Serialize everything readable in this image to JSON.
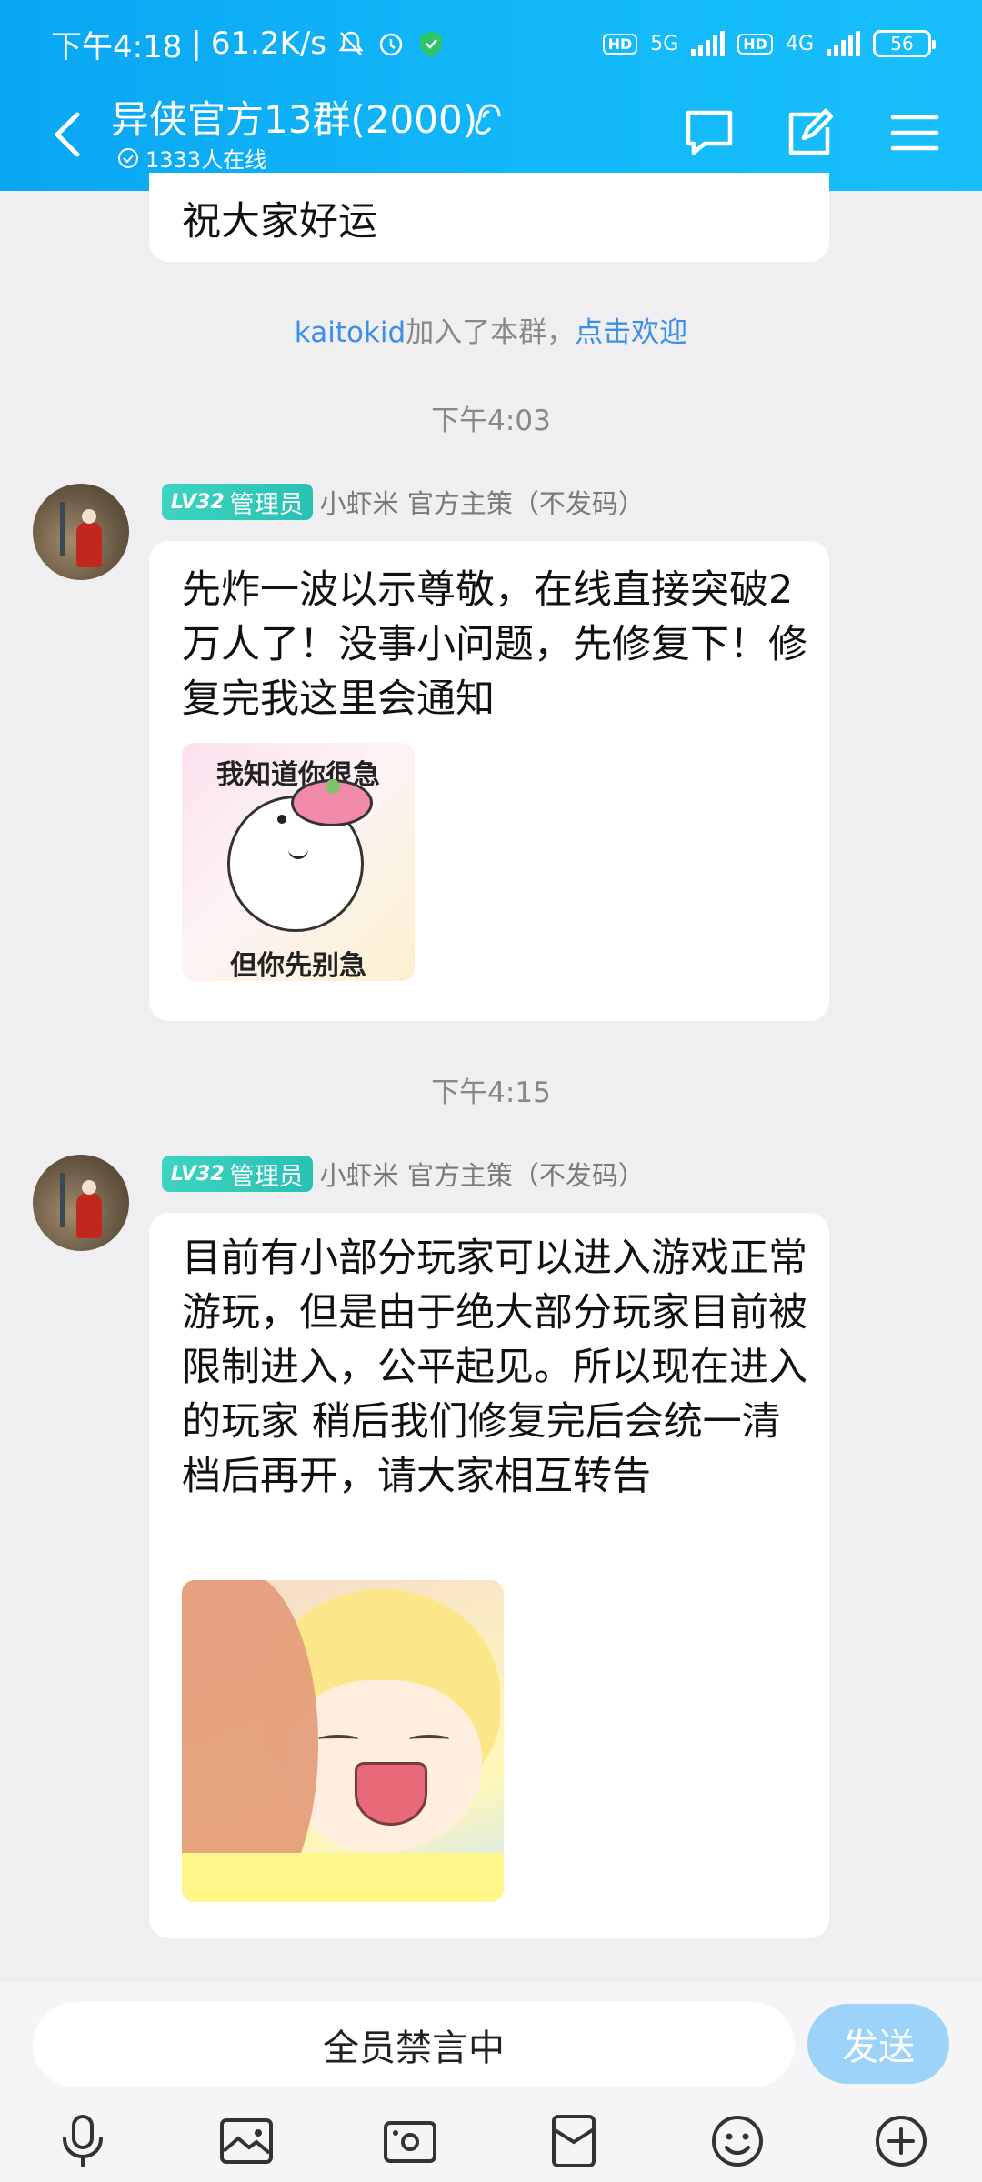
{
  "status_bar": {
    "time": "下午4:18",
    "speed": "61.2K/s",
    "network1": "5G",
    "network2": "4G",
    "hd": "HD",
    "battery": "56"
  },
  "header": {
    "title": "异侠官方13群(2000)",
    "online": "1333人在线",
    "icons": [
      "back-arrow",
      "ear-icon",
      "chat-icon",
      "edit-icon",
      "menu-icon"
    ]
  },
  "messages": {
    "prev_bubble_text": "祝大家好运",
    "join_notice": {
      "user": "kaitokid",
      "text": "加入了本群，",
      "action": "点击欢迎"
    },
    "time1": "下午4:03",
    "msg1": {
      "level": "LV32",
      "role": "管理员",
      "sender": "小虾米 官方主策（不发码）",
      "text": "先炸一波以示尊敬，在线直接突破2万人了！没事小问题，先修复下！修复完我这里会通知",
      "sticker_top": "我知道你很急",
      "sticker_bottom": "但你先别急"
    },
    "time2": "下午4:15",
    "msg2": {
      "level": "LV32",
      "role": "管理员",
      "sender": "小虾米 官方主策（不发码）",
      "text": "目前有小部分玩家可以进入游戏正常游玩，但是由于绝大部分玩家目前被限制进入，公平起见。所以现在进入的玩家 稍后我们修复完后会统一清档后再开，请大家相互转告"
    }
  },
  "input_bar": {
    "placeholder": "全员禁言中",
    "send_label": "发送",
    "tools": [
      "mic-icon",
      "image-icon",
      "camera-icon",
      "redpacket-icon",
      "emoji-icon",
      "plus-icon"
    ]
  },
  "colors": {
    "header": "#12b4f6",
    "badge": "#30c8b8",
    "link": "#3d8ee6",
    "send": "#9dd3f9"
  }
}
